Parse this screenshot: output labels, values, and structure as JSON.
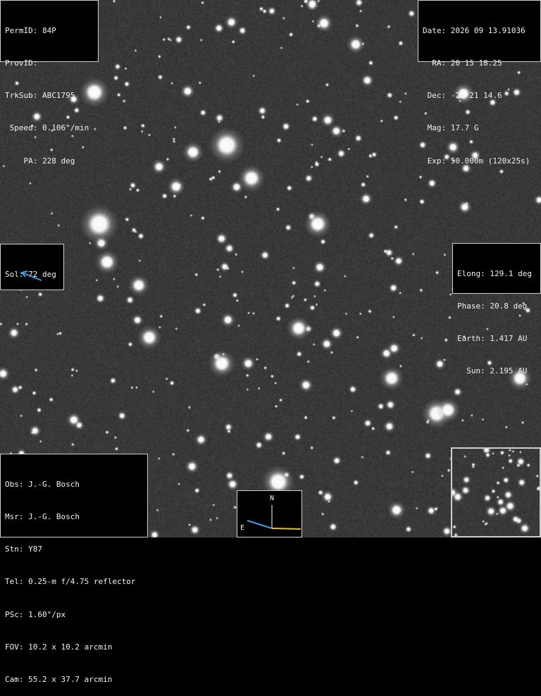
{
  "top_left": [
    "PermID: 84P",
    "ProvID:",
    "TrkSub: ABC1795",
    " Speed: 0.106\"/min",
    "    PA: 228 deg"
  ],
  "top_right": [
    "Date: 2026 09 13.91036",
    "  RA: 20 15 18.25",
    " Dec: -26 21 14.6",
    " Mag: 17.7 G",
    " Exp: 50.000m (120x25s)"
  ],
  "sol": {
    "label": "Sol: 72 deg",
    "arrow_color": "#3aa0e0"
  },
  "geometry_info": [
    "Elong: 129.1 deg",
    "Phase: 20.8 deg",
    "Earth: 1.417 AU",
    "  Sun: 2.195 AU"
  ],
  "observer": [
    "Obs: J.-G. Bosch",
    "Msr: J.-G. Bosch",
    "Stn: Y87",
    "Tel: 0.25-m f/4.75 reflector",
    "PSc: 1.60\"/px",
    "FOV: 10.2 x 10.2 arcmin",
    "Cam: 55.2 x 37.7 arcmin"
  ],
  "compass": {
    "north_label": "N",
    "east_label": "E",
    "east_color": "#3aa0e0",
    "motion_color": "#e8c020"
  }
}
